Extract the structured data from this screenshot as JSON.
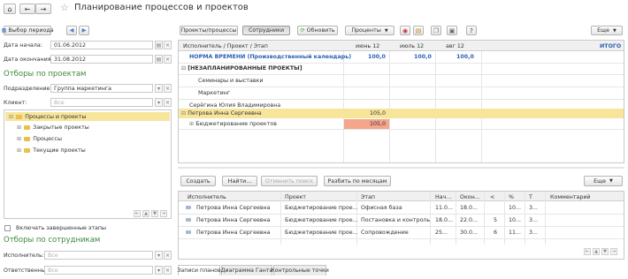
{
  "window": {
    "title": "Планирование процессов и проектов"
  },
  "toolbar": {
    "period_btn": "Выбор периода",
    "tab_processes": "Проекты/процессы",
    "tab_employees": "Сотрудники",
    "refresh": "Обновить",
    "percents": "Проценты",
    "more": "Еще",
    "help": "?"
  },
  "left": {
    "start_label": "Дата начала:",
    "start_value": "01.06.2012",
    "end_label": "Дата окончания:",
    "end_value": "31.08.2012",
    "project_filters_title": "Отборы по проектам",
    "division_label": "Подразделение:",
    "division_value": "Группа маркетинга",
    "client_label": "Клиент:",
    "client_placeholder": "Все",
    "tree": [
      "Процессы и проекты",
      "Закрытые проекты",
      "Процессы",
      "Текущие проекты"
    ],
    "include_completed": "Включать завершенные этапы",
    "employee_filters_title": "Отборы по сотрудникам",
    "executor_label": "Исполнитель:",
    "executor_placeholder": "Все",
    "responsible_label": "Ответственный:",
    "responsible_placeholder": "Все"
  },
  "grid": {
    "headers": [
      "Исполнитель / Проект / Этап",
      "июнь 12",
      "июль 12",
      "авг 12",
      "ИТОГО"
    ],
    "rows": [
      {
        "name": "НОРМА ВРЕМЕНИ (Производственный календарь)",
        "v1": "100,0",
        "v2": "100,0",
        "v3": "100,0"
      },
      {
        "name": "[НЕЗАПЛАНИРОВАННЫЕ ПРОЕКТЫ]",
        "v1": "",
        "v2": "",
        "v3": ""
      },
      {
        "name": "Семинары и выставки",
        "v1": "",
        "v2": "",
        "v3": ""
      },
      {
        "name": "Маркетинг",
        "v1": "",
        "v2": "",
        "v3": ""
      },
      {
        "name": "Серёгина Юлия Владимировна",
        "v1": "",
        "v2": "",
        "v3": ""
      },
      {
        "name": "Петрова Инна Сергеевна",
        "v1": "105,0",
        "v2": "",
        "v3": ""
      },
      {
        "name": "Бюджетирование проектов",
        "v1": "105,0",
        "v2": "",
        "v3": ""
      }
    ]
  },
  "bottom": {
    "create": "Создать",
    "find": "Найти...",
    "cancel_search": "Отменить поиск",
    "split_months": "Разбить по месяцам",
    "more": "Еще",
    "headers": [
      "Исполнитель",
      "Проект",
      "Этап",
      "Нач...",
      "Окон...",
      "<",
      "%",
      "Т",
      "Комментарий"
    ],
    "rows": [
      [
        "Петрова Инна Сергеевна",
        "Бюджетирование прое...",
        "Офисная база",
        "11.0...",
        "18.0...",
        "",
        "10...",
        "3...",
        ""
      ],
      [
        "Петрова Инна Сергеевна",
        "Бюджетирование прое...",
        "Постановка и контроль",
        "18.0...",
        "22.0...",
        "5",
        "10...",
        "3...",
        ""
      ],
      [
        "Петрова Инна Сергеевна",
        "Бюджетирование прое...",
        "Сопровождение",
        "25...",
        "30.0...",
        "6",
        "11...",
        "3...",
        ""
      ]
    ]
  },
  "tabs": [
    "Записи планов",
    "Диаграмма Ганта",
    "Контрольные точки"
  ]
}
